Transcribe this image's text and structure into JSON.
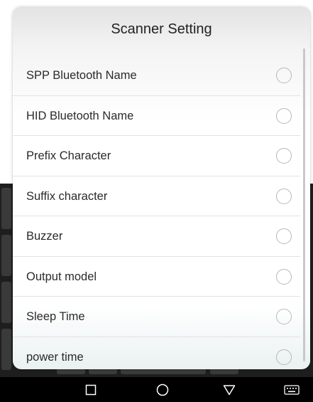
{
  "dialog": {
    "title": "Scanner Setting",
    "items": [
      {
        "label": "SPP Bluetooth Name",
        "selected": false
      },
      {
        "label": "HID Bluetooth Name",
        "selected": false
      },
      {
        "label": "Prefix Character",
        "selected": false
      },
      {
        "label": "Suffix character",
        "selected": false
      },
      {
        "label": "Buzzer",
        "selected": false
      },
      {
        "label": "Output model",
        "selected": false
      },
      {
        "label": "Sleep Time",
        "selected": false
      },
      {
        "label": "power time",
        "selected": false
      }
    ]
  },
  "nav_bar": {
    "icons": [
      "square-recents-icon",
      "circle-home-icon",
      "triangle-back-icon",
      "keyboard-icon"
    ]
  },
  "colors": {
    "nav_background": "#000000",
    "radio_border": "#b8b8b8",
    "divider": "#e2e2e2",
    "background_keyboard": "#1e1e1e"
  }
}
